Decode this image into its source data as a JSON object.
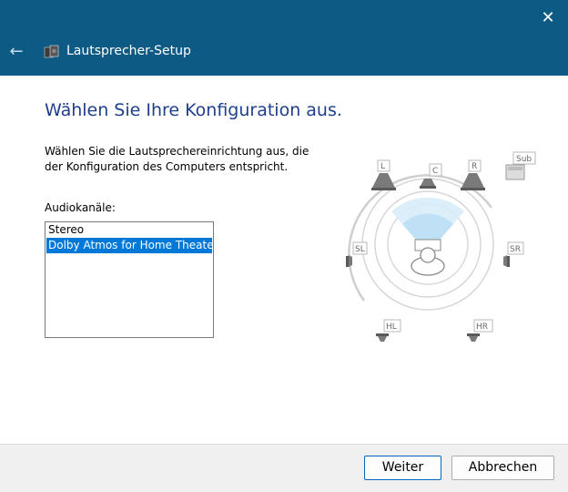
{
  "window": {
    "title": "Lautsprecher-Setup",
    "close_glyph": "✕",
    "back_glyph": "←"
  },
  "main": {
    "heading": "Wählen Sie Ihre Konfiguration aus.",
    "description_line1": "Wählen Sie die Lautsprechereinrichtung aus, die",
    "description_line2": "der Konfiguration des Computers entspricht.",
    "list_label": "Audiokanäle:",
    "audio_channels": [
      {
        "label": "Stereo",
        "selected": false
      },
      {
        "label": "Dolby Atmos for Home Theater",
        "selected": true
      }
    ]
  },
  "diagram": {
    "speakers": {
      "front_left": "L",
      "center": "C",
      "front_right": "R",
      "subwoofer": "Sub",
      "side_left": "SL",
      "side_right": "SR",
      "height_left": "HL",
      "height_right": "HR"
    }
  },
  "footer": {
    "next_label": "Weiter",
    "cancel_label": "Abbrechen"
  },
  "colors": {
    "title_bar": "#0d5a84",
    "heading": "#1e3f8c",
    "selection": "#0078d7"
  }
}
